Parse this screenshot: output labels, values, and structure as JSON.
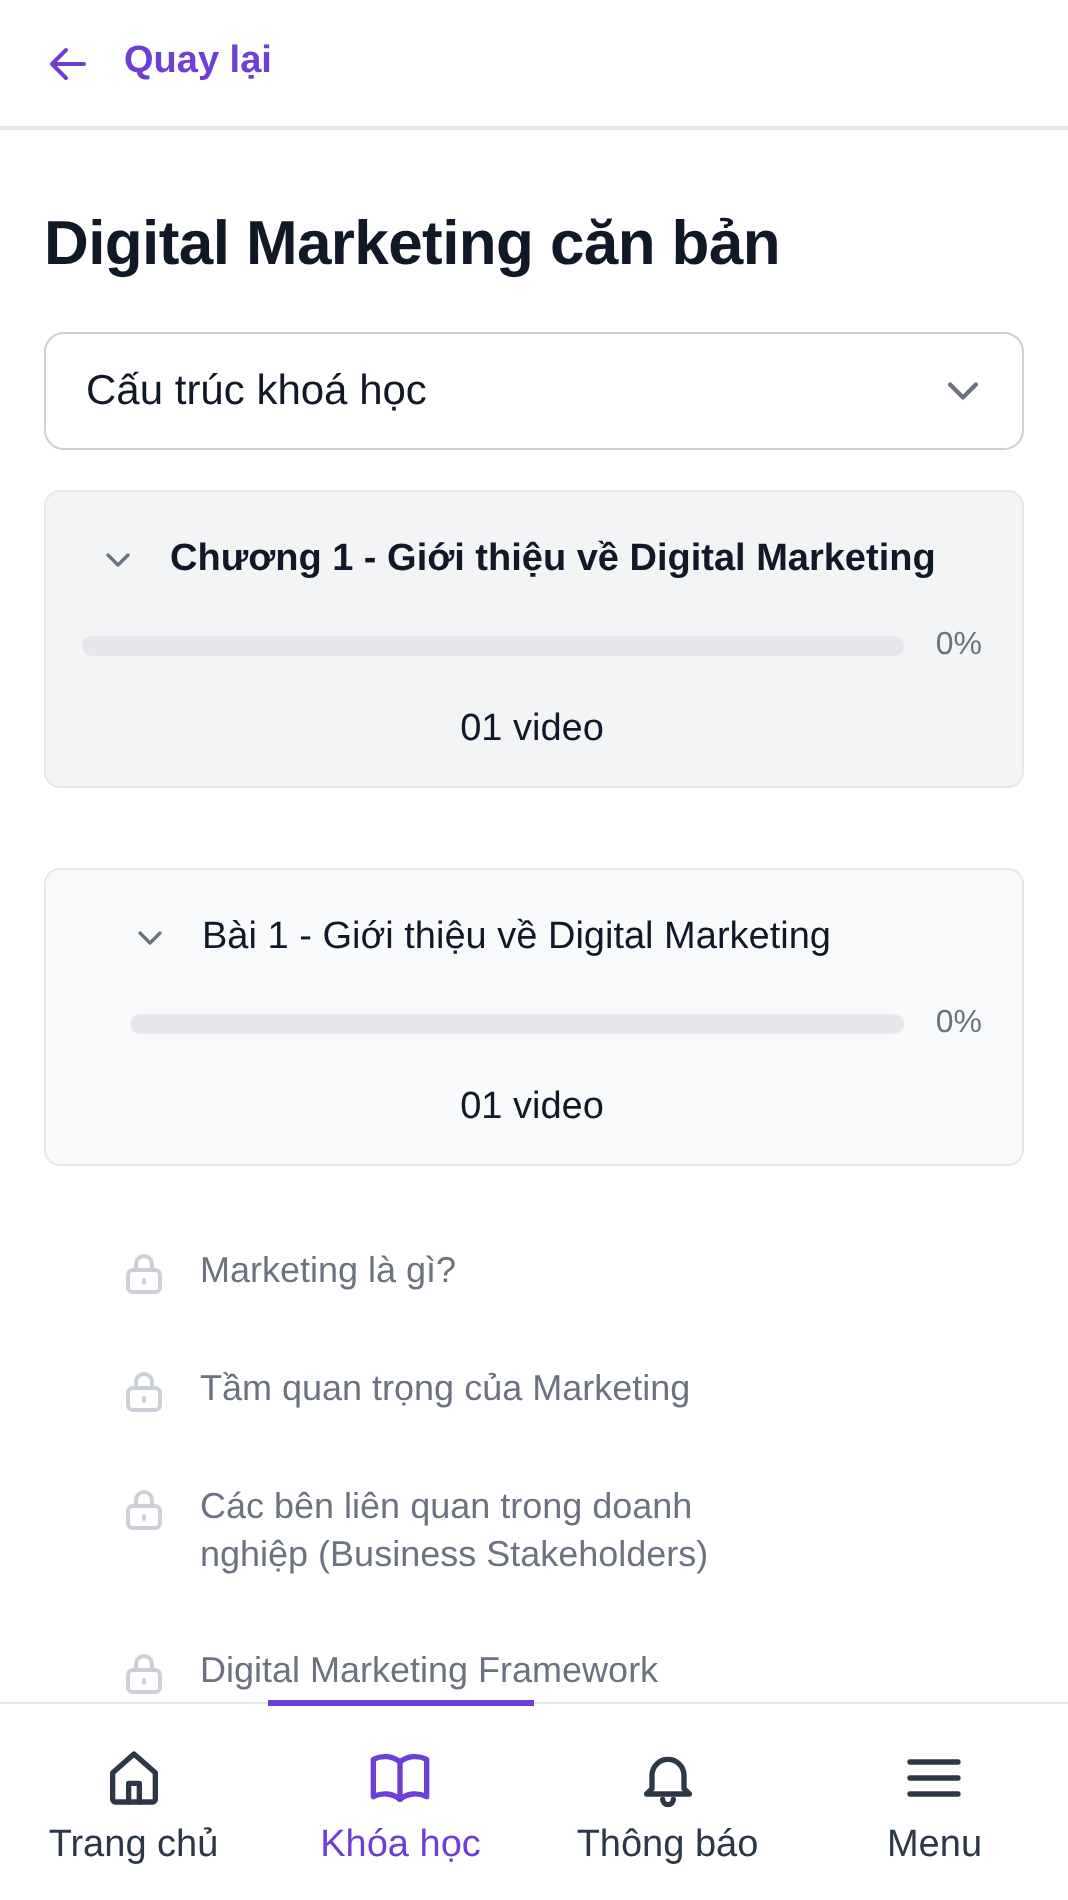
{
  "header": {
    "back_label": "Quay lại"
  },
  "title": "Digital Marketing căn bản",
  "structure_select": {
    "value": "Cấu trúc khoá học"
  },
  "sections": [
    {
      "kind": "chapter",
      "title": "Chương 1 - Giới thiệu về Digital Marketing",
      "expanded": true,
      "level": 0,
      "percent": "0%",
      "videos": "01 video"
    },
    {
      "kind": "lesson",
      "title": "Bài 1 - Giới thiệu về Digital Marketing",
      "expanded": true,
      "level": 0,
      "percent": "0%",
      "videos": "01 video"
    }
  ],
  "items": [
    {
      "title": "Marketing là gì?",
      "locked": true
    },
    {
      "title": "Tầm quan trọng của Marketing",
      "locked": true
    },
    {
      "title": "Các bên liên quan trong doanh nghiệp (Business Stakeholders)",
      "locked": true
    },
    {
      "title": "Digital Marketing Framework",
      "locked": true
    }
  ],
  "bottom_nav": [
    {
      "kind": "home",
      "label": "Trang chủ",
      "selected": false
    },
    {
      "kind": "book",
      "label": "Khóa học",
      "selected": true
    },
    {
      "kind": "bell",
      "label": "Thông báo",
      "selected": false
    },
    {
      "kind": "menu",
      "label": "Menu",
      "selected": false
    }
  ]
}
